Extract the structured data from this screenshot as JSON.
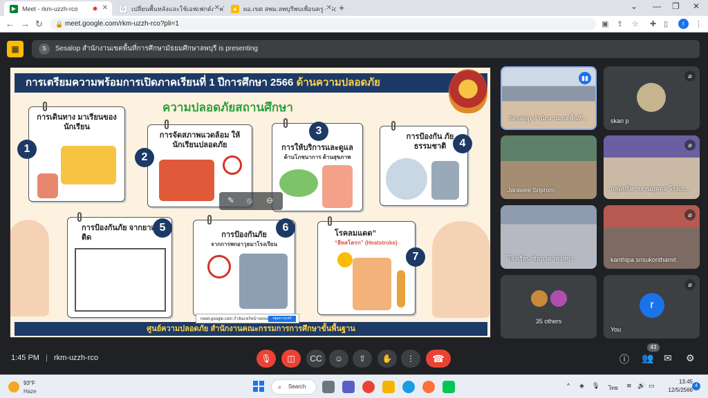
{
  "browser": {
    "tabs": [
      {
        "title": "Meet - rkm-uzzh-rco",
        "favicon": "meet-icon",
        "active": true,
        "recording": true
      },
      {
        "title": "เปลี่ยนพื้นหลังและใช้เอฟเฟกต์ภาพใน Google",
        "favicon": "google-icon"
      },
      {
        "title": "ผอ.เขต สพม.ลพบุรีพบเพื่อนครู - Google",
        "favicon": "drive-icon"
      }
    ],
    "new_tab": "+",
    "url": "meet.google.com/rkm-uzzh-rco?pli=1",
    "profile_initial": "r"
  },
  "presenting": {
    "avatar_initial": "S",
    "text": "Sesalop สำนักงานเขตพื้นที่การศึกษามัธยมศึกษาลพบุรี is presenting"
  },
  "slide": {
    "title_main": "การเตรียมความพร้อมการเปิดภาคเรียนที่ 1 ปีการศึกษา 2566",
    "title_highlight": "ด้านความปลอดภัย",
    "subtitle": "ความปลอดภัยสถานศึกษา",
    "items": [
      {
        "num": "1",
        "text": "การเดินทาง มาเรียนของนักเรียน",
        "sub": ""
      },
      {
        "num": "2",
        "text": "การจัดสภาพแวดล้อม ให้นักเรียนปลอดภัย",
        "sub": ""
      },
      {
        "num": "3",
        "text": "การให้บริการและดูแล",
        "sub": "ด้านโภชนาการ ด้านสุขภาพ"
      },
      {
        "num": "4",
        "text": "การป้องกัน ภัยธรรมชาติ",
        "sub": ""
      },
      {
        "num": "5",
        "text": "การป้องกันภัย จากยาเสพติด",
        "sub": ""
      },
      {
        "num": "6",
        "text": "การป้องกันภัย",
        "sub": "จากการพกอาวุธมาโรงเรียน"
      },
      {
        "num": "7",
        "text": "โรคลมแดด”",
        "sub": "“ฮีทสโตรก” (Heatstroke)"
      }
    ],
    "footer": "ศูนย์ความปลอดภัย สำนักงานคณะกรรมการการศึกษาขั้นพื้นฐาน",
    "chip_text": "meet.google.com กำลังแชร์หน้าจอของคุณ",
    "chip_button": "หยุดการแชร์"
  },
  "participants": [
    {
      "name": "Sesalop สำนักงานเขตพื้นที่...",
      "speaking": true
    },
    {
      "name": "skan p",
      "muted": true
    },
    {
      "name": "Jarawee Sriprom",
      "muted": false
    },
    {
      "name": "กลุ่มบริหารงานบุคคล โรงเร...",
      "muted": true
    },
    {
      "name": "โรงเรียน ชัยบาดาลวิทยา",
      "muted": false
    },
    {
      "name": "kanthipa srisukonthamit",
      "muted": true
    },
    {
      "name": "35 others"
    },
    {
      "name": "You",
      "initial": "r",
      "muted": true
    }
  ],
  "bottom": {
    "time": "1:45 PM",
    "separator": "|",
    "meeting_code": "rkm-uzzh-rco",
    "participant_count": "43"
  },
  "taskbar": {
    "temp": "93°F",
    "weather": "Haze",
    "search": "Search",
    "lang": "ไทย",
    "time": "13:45",
    "date": "12/5/2566",
    "notifications": "4"
  },
  "colors": {
    "meet_bg": "#202124",
    "tile_bg": "#3c4043",
    "danger": "#ea4335",
    "slide_navy": "#1d3a66",
    "slide_green": "#2e9e3d"
  }
}
